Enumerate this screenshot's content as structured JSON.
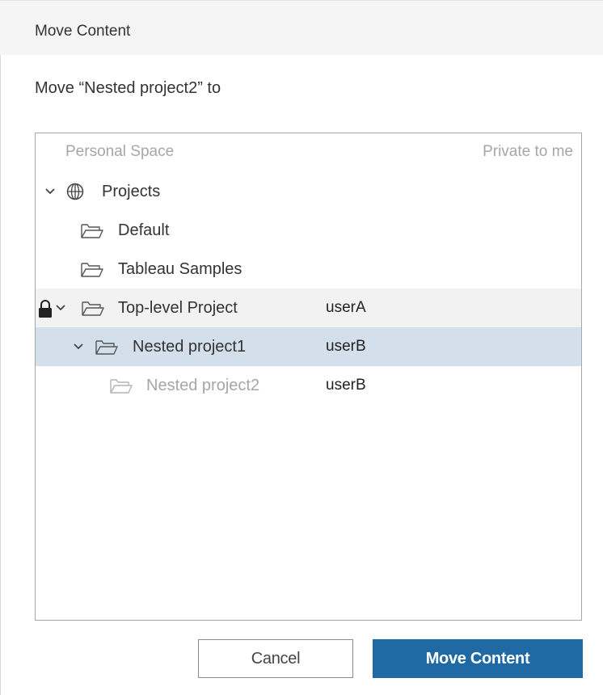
{
  "dialog": {
    "title": "Move Content",
    "prompt": "Move “Nested project2” to"
  },
  "tree": {
    "personal_space": {
      "label": "Personal Space",
      "note": "Private to me"
    },
    "projects": {
      "label": "Projects",
      "icon": "globe-icon"
    },
    "items": [
      {
        "label": "Default",
        "owner": "",
        "icon": "folder-icon"
      },
      {
        "label": "Tableau Samples",
        "owner": "",
        "icon": "folder-icon"
      },
      {
        "label": "Top-level Project",
        "owner": "userA",
        "icon": "folder-icon",
        "locked": true,
        "expanded": true
      },
      {
        "label": "Nested project1",
        "owner": "userB",
        "icon": "folder-icon",
        "expanded": true,
        "selected": true
      },
      {
        "label": "Nested project2",
        "owner": "userB",
        "icon": "folder-icon",
        "disabled": true
      }
    ]
  },
  "buttons": {
    "cancel": "Cancel",
    "move": "Move Content"
  },
  "colors": {
    "primary": "#1f6aa5",
    "selected_row": "#d3dfea",
    "hover_row": "#f2f2f2",
    "muted_text": "#a6a6a6"
  }
}
